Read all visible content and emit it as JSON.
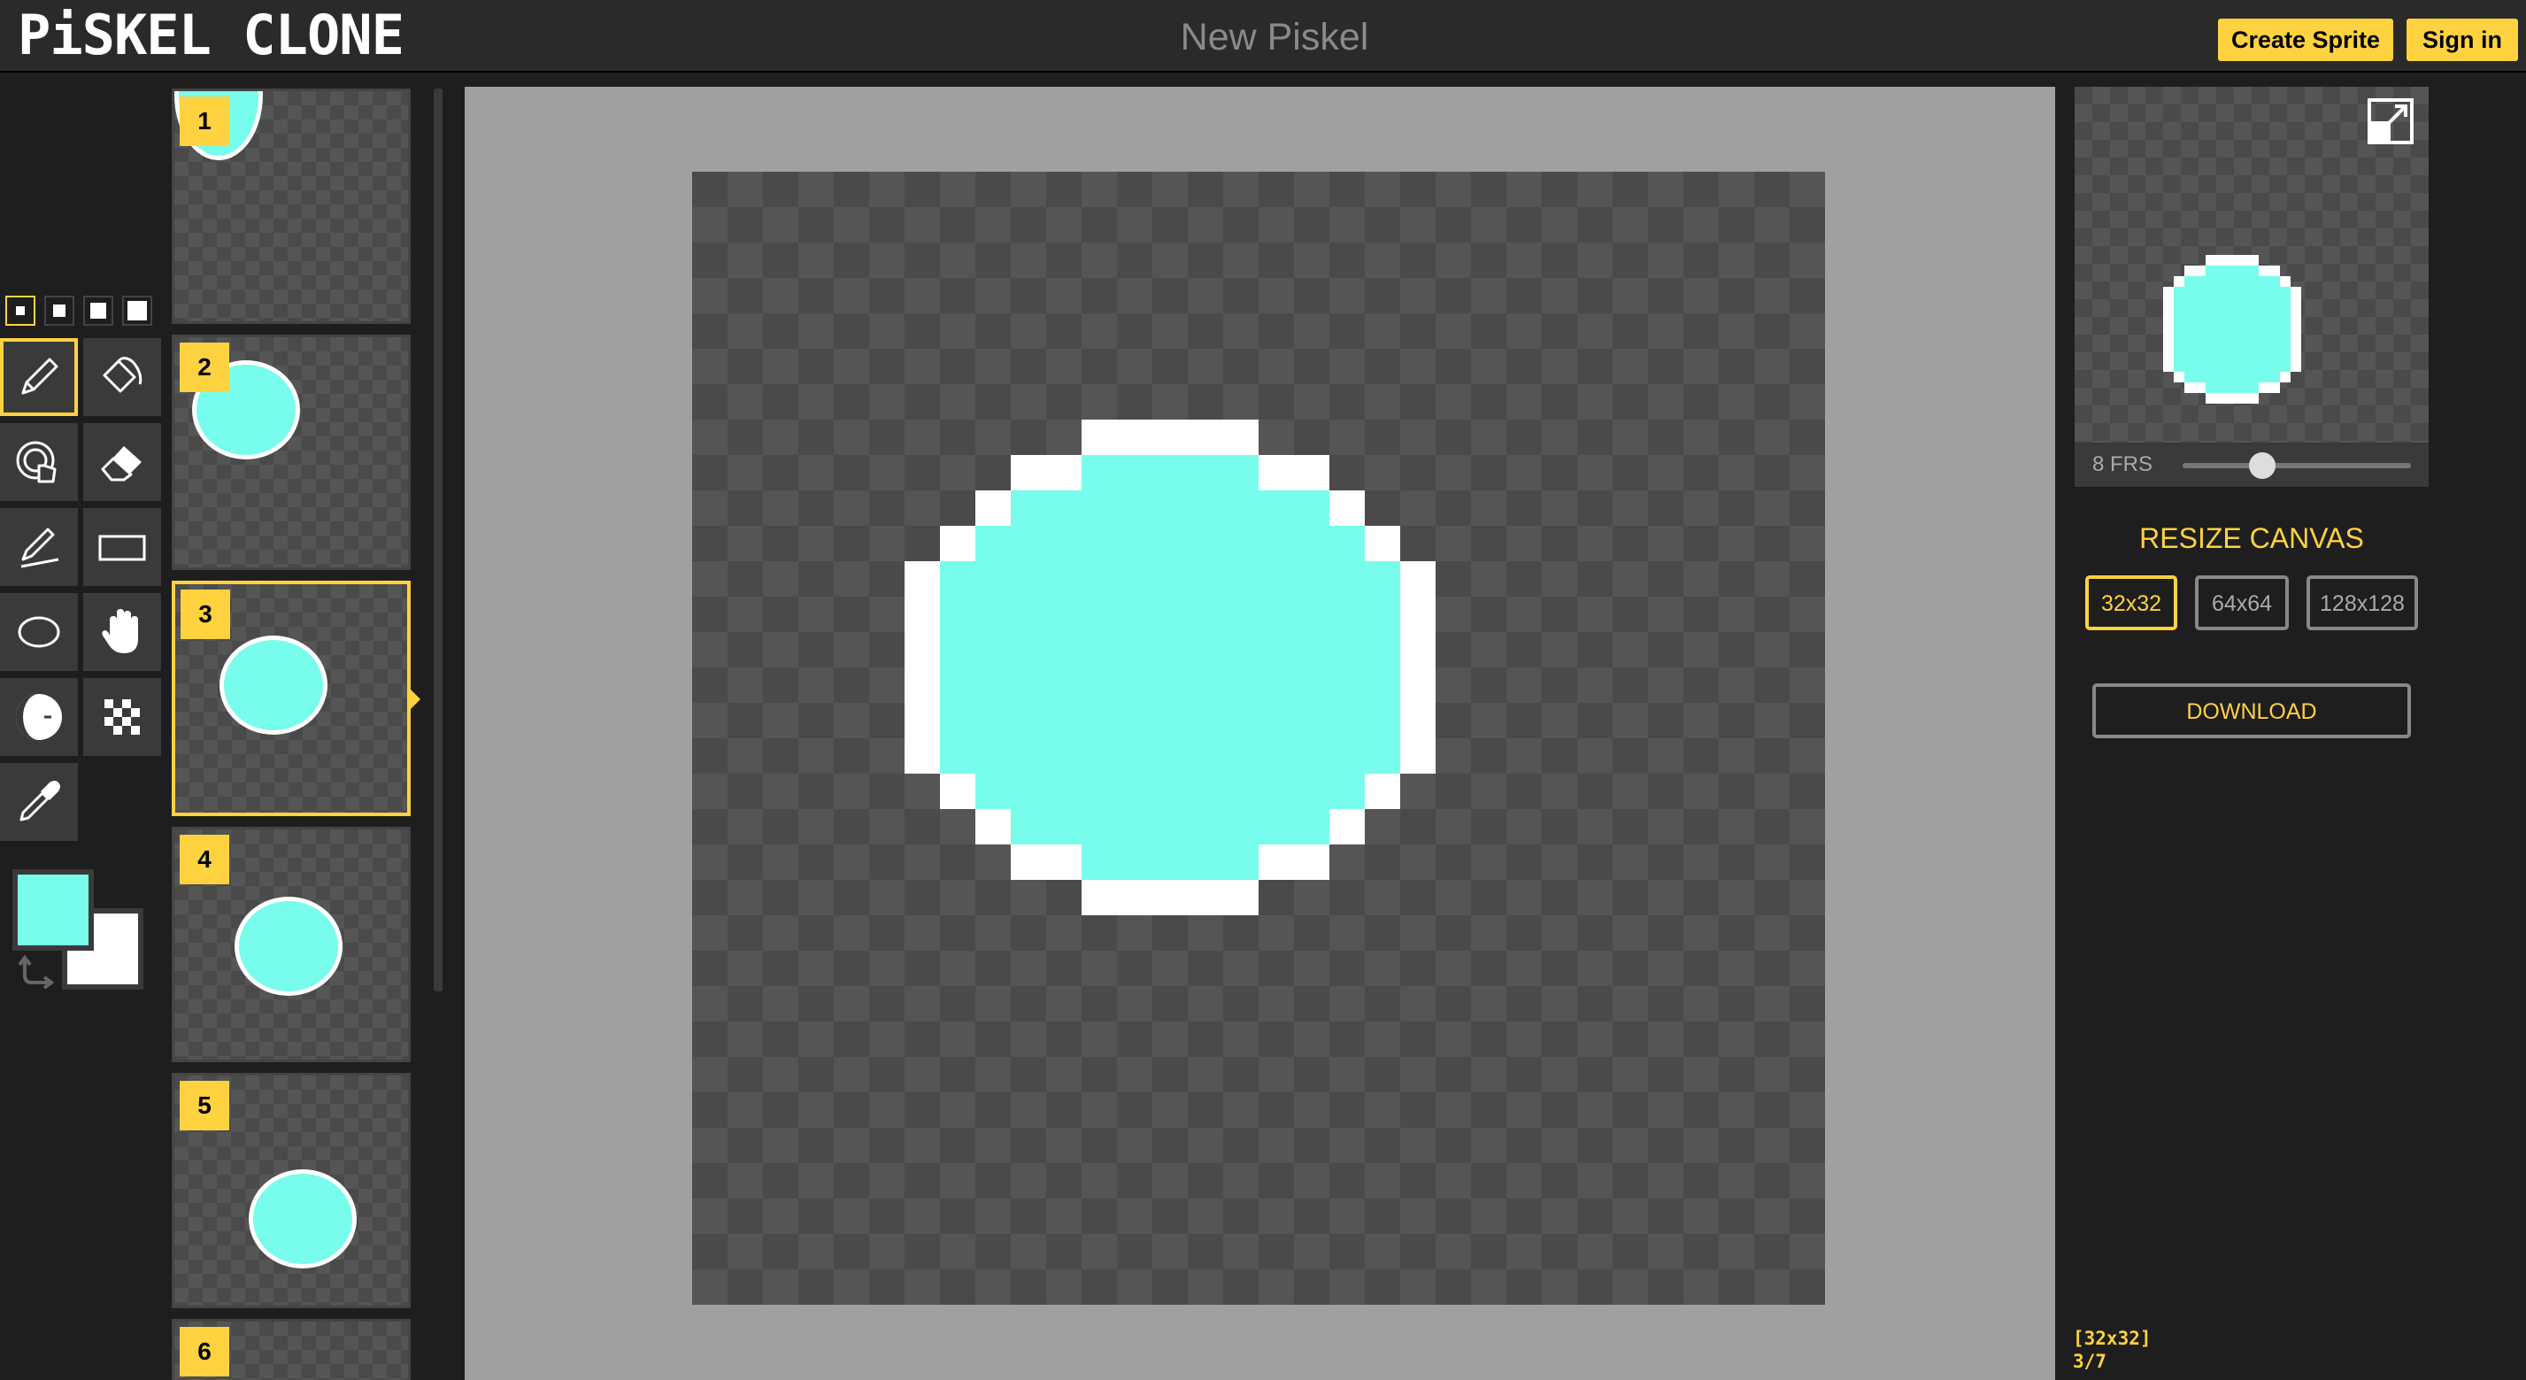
{
  "header": {
    "logo": "PiSKEL CLONE",
    "title": "New Piskel",
    "create_sprite": "Create Sprite",
    "sign_in": "Sign in"
  },
  "tools": {
    "pen_sizes": [
      1,
      2,
      3,
      4
    ],
    "selected_pen_size": 1,
    "items": [
      {
        "name": "pen-tool",
        "icon": "pen-icon",
        "selected": true
      },
      {
        "name": "paint-bucket-tool",
        "icon": "paint-bucket-icon",
        "selected": false
      },
      {
        "name": "color-fill-tool",
        "icon": "target-hand-icon",
        "selected": false
      },
      {
        "name": "eraser-tool",
        "icon": "eraser-icon",
        "selected": false
      },
      {
        "name": "stroke-tool",
        "icon": "stroke-icon",
        "selected": false
      },
      {
        "name": "rectangle-tool",
        "icon": "rectangle-icon",
        "selected": false
      },
      {
        "name": "circle-tool",
        "icon": "circle-icon",
        "selected": false
      },
      {
        "name": "move-tool",
        "icon": "hand-icon",
        "selected": false
      },
      {
        "name": "lighten-tool",
        "icon": "lighten-darken-icon",
        "selected": false
      },
      {
        "name": "dithering-tool",
        "icon": "checker-icon",
        "selected": false
      },
      {
        "name": "color-picker-tool",
        "icon": "eyedropper-icon",
        "selected": false
      }
    ],
    "primary_color": "#78fceb",
    "secondary_color": "#ffffff"
  },
  "frames": {
    "items": [
      {
        "number": "1"
      },
      {
        "number": "2"
      },
      {
        "number": "3"
      },
      {
        "number": "4"
      },
      {
        "number": "5"
      },
      {
        "number": "6"
      }
    ],
    "selected": 3
  },
  "preview": {
    "fps_label": "8 FRS",
    "fps_fraction": 0.35
  },
  "resize": {
    "title": "RESIZE CANVAS",
    "options": [
      "32x32",
      "64x64",
      "128x128"
    ],
    "selected": "32x32",
    "download": "DOWNLOAD"
  },
  "status": {
    "size": "[32x32]",
    "frame": "3/7"
  },
  "colors": {
    "accent": "#ffd23f",
    "sprite": "#78fceb"
  }
}
